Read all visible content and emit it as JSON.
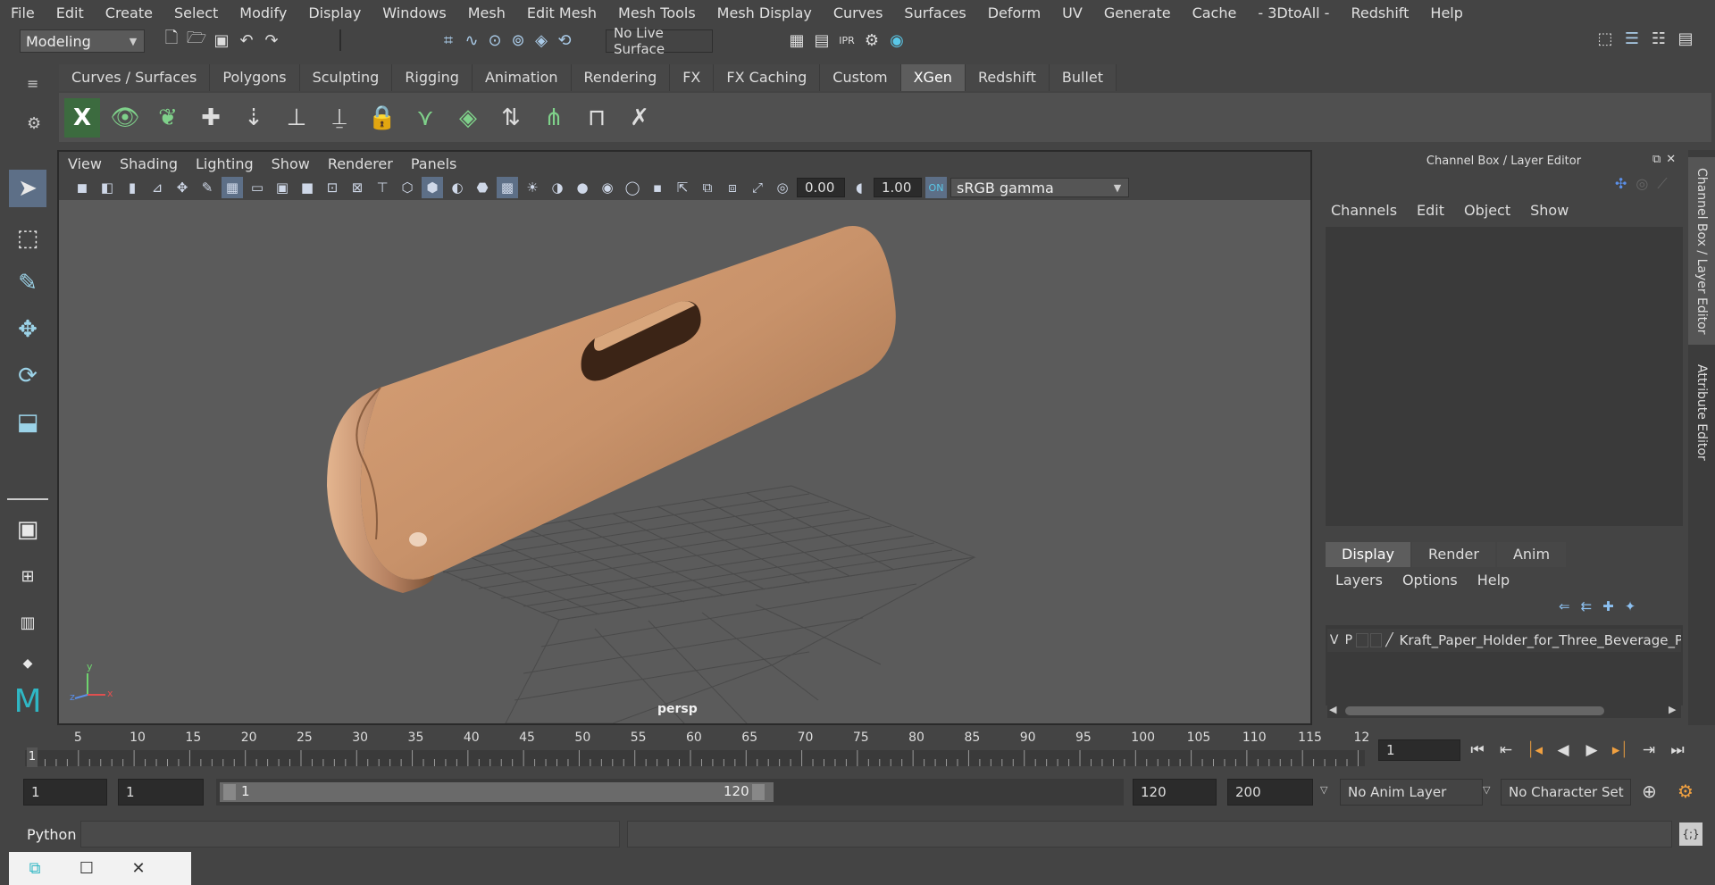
{
  "menubar": {
    "items": [
      "File",
      "Edit",
      "Create",
      "Select",
      "Modify",
      "Display",
      "Windows",
      "Mesh",
      "Edit Mesh",
      "Mesh Tools",
      "Mesh Display",
      "Curves",
      "Surfaces",
      "Deform",
      "UV",
      "Generate",
      "Cache",
      "- 3DtoAll -",
      "Redshift",
      "Help"
    ]
  },
  "statusline": {
    "mode": "Modeling",
    "live_surface": "No Live Surface"
  },
  "shelf": {
    "tabs": [
      "Curves / Surfaces",
      "Polygons",
      "Sculpting",
      "Rigging",
      "Animation",
      "Rendering",
      "FX",
      "FX Caching",
      "Custom",
      "XGen",
      "Redshift",
      "Bullet"
    ],
    "active_tab": "XGen"
  },
  "viewport": {
    "menu": [
      "View",
      "Shading",
      "Lighting",
      "Show",
      "Renderer",
      "Panels"
    ],
    "exposure": "0.00",
    "gamma": "1.00",
    "color_space": "sRGB gamma",
    "camera_label": "persp",
    "axis_x": "x",
    "axis_y": "y",
    "axis_z": "z"
  },
  "channel_box": {
    "title": "Channel Box / Layer Editor",
    "menu": [
      "Channels",
      "Edit",
      "Object",
      "Show"
    ],
    "side_tab_1": "Channel Box / Layer Editor",
    "side_tab_2": "Attribute Editor"
  },
  "layer_editor": {
    "tabs": [
      "Display",
      "Render",
      "Anim"
    ],
    "active_tab": "Display",
    "menu": [
      "Layers",
      "Options",
      "Help"
    ],
    "layer": {
      "visible": "V",
      "playback": "P",
      "name": "Kraft_Paper_Holder_for_Three_Beverage_Pla"
    }
  },
  "timeslider": {
    "ticks": [
      "5",
      "10",
      "15",
      "20",
      "25",
      "30",
      "35",
      "40",
      "45",
      "50",
      "55",
      "60",
      "65",
      "70",
      "75",
      "80",
      "85",
      "90",
      "95",
      "100",
      "105",
      "110",
      "115",
      "12"
    ],
    "current_frame_marker": "1",
    "current_frame_field": "1"
  },
  "rangebar": {
    "start": "1",
    "playback_start": "1",
    "range_start_label": "1",
    "range_end_label": "120",
    "playback_end": "120",
    "end": "200",
    "anim_layer": "No Anim Layer",
    "character_set": "No Character Set"
  },
  "cmdline": {
    "label": "Python"
  },
  "colors": {
    "accent_active": "#5d6f87",
    "shelf_icon": "#7fd18a",
    "model": "#c8926a"
  }
}
